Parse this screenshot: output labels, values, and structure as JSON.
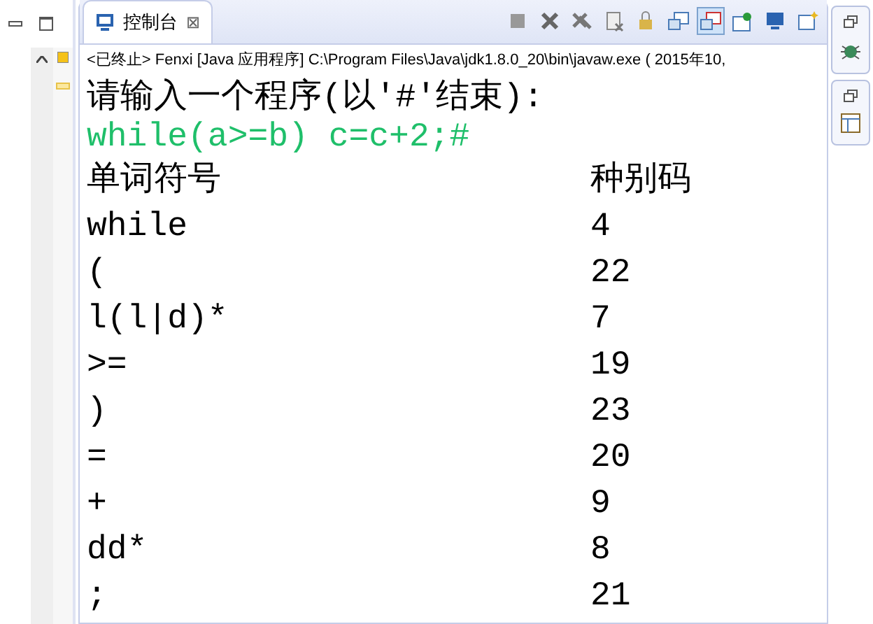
{
  "console": {
    "tab": {
      "label": "控制台",
      "close": "⊠"
    },
    "toolbar": [
      {
        "kind": "stop",
        "selected": false
      },
      {
        "kind": "remove",
        "selected": false
      },
      {
        "kind": "remove-all",
        "selected": false
      },
      {
        "kind": "clear",
        "selected": false
      },
      {
        "kind": "lock",
        "selected": false
      },
      {
        "kind": "out",
        "selected": false
      },
      {
        "kind": "err",
        "selected": true
      },
      {
        "kind": "pin",
        "selected": false
      },
      {
        "kind": "display",
        "selected": false
      },
      {
        "kind": "new",
        "selected": false
      }
    ],
    "status": "<已终止> Fenxi [Java 应用程序] C:\\Program Files\\Java\\jdk1.8.0_20\\bin\\javaw.exe ( 2015年10,",
    "prompt": "请输入一个程序(以'#'结束):",
    "input": "while(a>=b) c=c+2;#",
    "header": [
      "单词符号",
      "种别码"
    ],
    "rows": [
      [
        "while",
        "4"
      ],
      [
        "(",
        "22"
      ],
      [
        "l(l|d)*",
        "7"
      ],
      [
        ">=",
        "19"
      ],
      [
        ")",
        "23"
      ],
      [
        "=",
        "20"
      ],
      [
        "+",
        "9"
      ],
      [
        "dd*",
        "8"
      ],
      [
        ";",
        "21"
      ]
    ]
  }
}
